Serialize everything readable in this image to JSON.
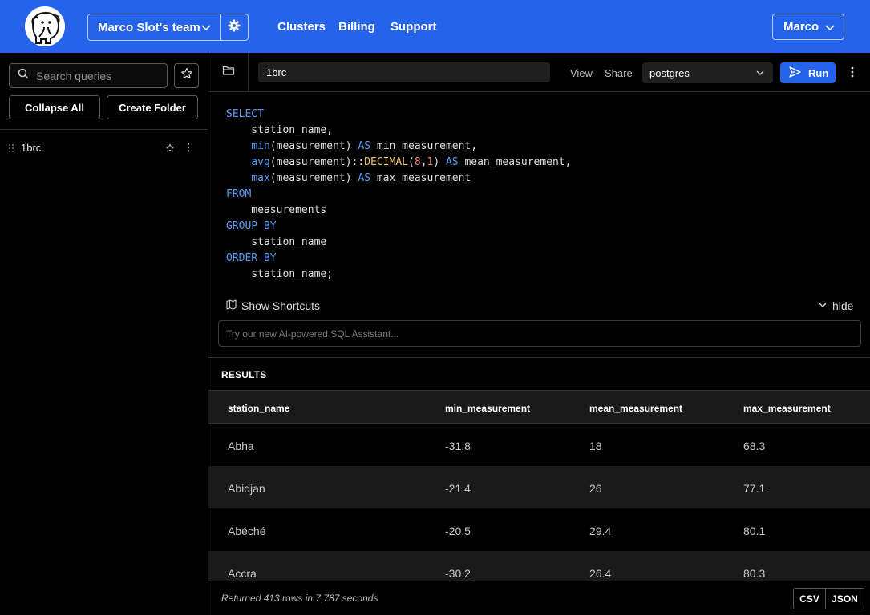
{
  "header": {
    "team_name": "Marco Slot's team",
    "nav": [
      "Clusters",
      "Billing",
      "Support"
    ],
    "user_name": "Marco",
    "brand_color": "#2563eb"
  },
  "sidebar": {
    "search_placeholder": "Search queries",
    "collapse_label": "Collapse All",
    "create_folder_label": "Create Folder",
    "queries": [
      {
        "name": "1brc"
      }
    ]
  },
  "toolbar": {
    "query_name": "1brc",
    "view_label": "View",
    "share_label": "Share",
    "database": "postgres",
    "run_label": "Run"
  },
  "editor": {
    "show_shortcuts_label": "Show Shortcuts",
    "hide_label": "hide",
    "ai_placeholder": "Try our new AI-powered SQL Assistant..."
  },
  "results": {
    "title": "RESULTS",
    "columns": [
      "station_name",
      "min_measurement",
      "mean_measurement",
      "max_measurement"
    ],
    "rows": [
      [
        "Abha",
        "-31.8",
        "18",
        "68.3"
      ],
      [
        "Abidjan",
        "-21.4",
        "26",
        "77.1"
      ],
      [
        "Abéché",
        "-20.5",
        "29.4",
        "80.1"
      ],
      [
        "Accra",
        "-30.2",
        "26.4",
        "80.3"
      ]
    ],
    "status": "Returned 413 rows in 7,787 seconds",
    "export_csv": "CSV",
    "export_json": "JSON"
  }
}
